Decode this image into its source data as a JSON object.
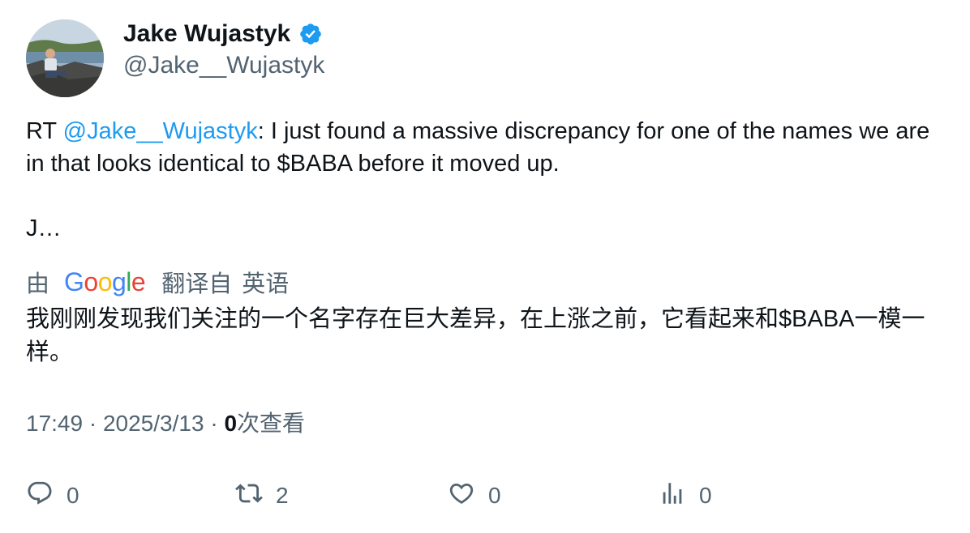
{
  "author": {
    "display_name": "Jake Wujastyk",
    "handle": "@Jake__Wujastyk",
    "verified": true
  },
  "tweet": {
    "prefix": "RT ",
    "mention": "@Jake__Wujastyk",
    "body": ": I just found a massive discrepancy for one of the names we are in that looks identical to $BABA before it moved up.",
    "tail": "J…"
  },
  "translation": {
    "by_label": "由",
    "provider": "Google",
    "from_label": "翻译自",
    "language": "英语",
    "text": "我刚刚发现我们关注的一个名字存在巨大差异，在上涨之前，它看起来和$BABA一模一样。"
  },
  "meta": {
    "time": "17:49",
    "separator": " · ",
    "date": "2025/3/13",
    "views_count": "0",
    "views_label": "次查看"
  },
  "actions": {
    "replies": "0",
    "retweets": "2",
    "likes": "0",
    "views": "0"
  },
  "colors": {
    "accent": "#1d9bf0",
    "secondary_text": "#536471",
    "primary_text": "#0f1419"
  },
  "icons": {
    "verified": "verified-badge-icon",
    "reply": "reply-icon",
    "retweet": "retweet-icon",
    "like": "heart-icon",
    "views": "views-chart-icon"
  }
}
